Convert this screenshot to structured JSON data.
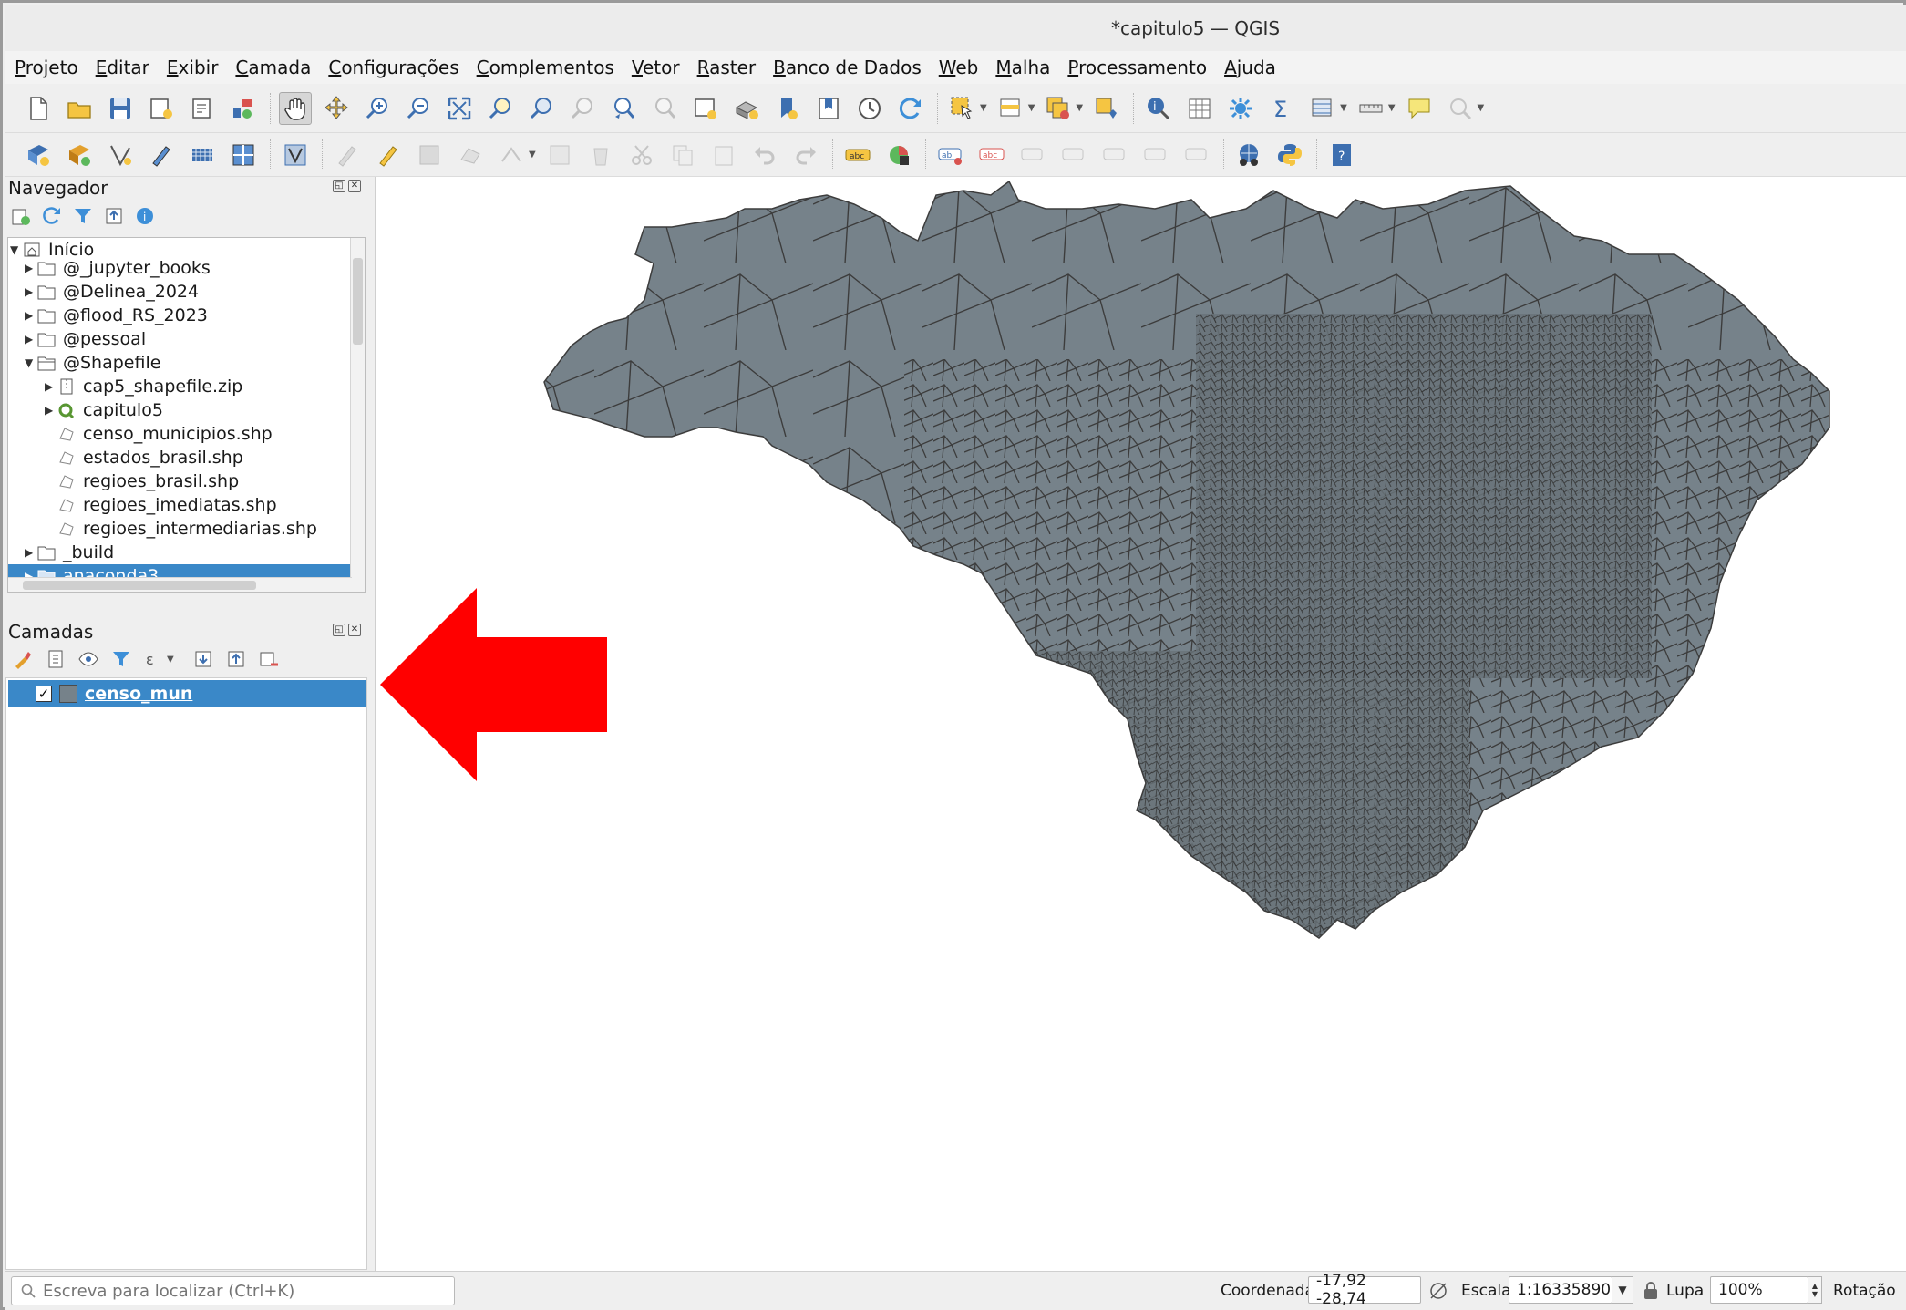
{
  "window": {
    "title": "*capitulo5 — QGIS"
  },
  "menu": [
    "Projeto",
    "Editar",
    "Exibir",
    "Camada",
    "Configurações",
    "Complementos",
    "Vetor",
    "Raster",
    "Banco de Dados",
    "Web",
    "Malha",
    "Processamento",
    "Ajuda"
  ],
  "browser": {
    "title": "Navegador",
    "root": "Início",
    "items": [
      {
        "label": "@_jupyter_books",
        "kind": "folder"
      },
      {
        "label": "@Delinea_2024",
        "kind": "folder"
      },
      {
        "label": "@flood_RS_2023",
        "kind": "folder"
      },
      {
        "label": "@pessoal",
        "kind": "folder"
      },
      {
        "label": "@Shapefile",
        "kind": "folder-open"
      },
      {
        "label": "cap5_shapefile.zip",
        "kind": "zip"
      },
      {
        "label": "capitulo5",
        "kind": "qgis-project"
      },
      {
        "label": "censo_municipios.shp",
        "kind": "shapefile"
      },
      {
        "label": "estados_brasil.shp",
        "kind": "shapefile"
      },
      {
        "label": "regioes_brasil.shp",
        "kind": "shapefile"
      },
      {
        "label": "regioes_imediatas.shp",
        "kind": "shapefile"
      },
      {
        "label": "regioes_intermediarias.shp",
        "kind": "shapefile"
      },
      {
        "label": "_build",
        "kind": "folder"
      },
      {
        "label": "anaconda3",
        "kind": "folder",
        "selected": true
      }
    ]
  },
  "layers": {
    "title": "Camadas",
    "items": [
      {
        "name": "censo_mun",
        "checked": true,
        "fill_color": "#76828a"
      }
    ]
  },
  "map": {
    "fill_color": "#76828a",
    "stroke_color": "#3c3c3c",
    "annotation_arrow_color": "#ff0000"
  },
  "status": {
    "locator_placeholder": "Escreva para localizar (Ctrl+K)",
    "coordinate_label": "Coordenada",
    "coordinate_value": "-17,92 -28,74",
    "scale_label": "Escala",
    "scale_value": "1:16335890",
    "magnifier_label": "Lupa",
    "magnifier_value": "100%",
    "rotation_label": "Rotação"
  }
}
